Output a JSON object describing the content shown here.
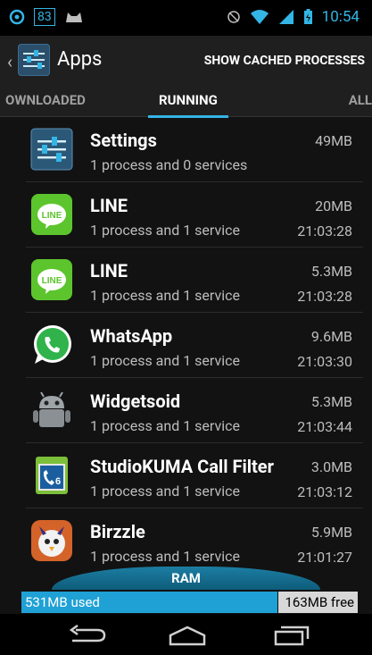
{
  "status": {
    "left_badge": "83",
    "time": "10:54",
    "colors": {
      "accent": "#33b5e5"
    }
  },
  "actionbar": {
    "title": "Apps",
    "action": "SHOW CACHED PROCESSES"
  },
  "tabs": [
    {
      "label": "OWNLOADED"
    },
    {
      "label": "RUNNING"
    },
    {
      "label": "ALL"
    }
  ],
  "apps": [
    {
      "name": "Settings",
      "detail": "1 process and 0 services",
      "size": "49MB",
      "time": "",
      "icon": "settings-icon"
    },
    {
      "name": "LINE",
      "detail": "1 process and 1 service",
      "size": "20MB",
      "time": "21:03:28",
      "icon": "line-icon"
    },
    {
      "name": "LINE",
      "detail": "1 process and 1 service",
      "size": "5.3MB",
      "time": "21:03:28",
      "icon": "line-icon"
    },
    {
      "name": "WhatsApp",
      "detail": "1 process and 1 service",
      "size": "9.6MB",
      "time": "21:03:30",
      "icon": "whatsapp-icon"
    },
    {
      "name": "Widgetsoid",
      "detail": "1 process and 1 service",
      "size": "5.3MB",
      "time": "21:03:44",
      "icon": "android-robot-icon"
    },
    {
      "name": "StudioKUMA Call Filter",
      "detail": "1 process and 1 service",
      "size": "3.0MB",
      "time": "21:03:12",
      "icon": "call-filter-icon"
    },
    {
      "name": "Birzzle",
      "detail": "1 process and 1 service",
      "size": "5.9MB",
      "time": "21:01:27",
      "icon": "birzzle-icon"
    }
  ],
  "ram": {
    "label": "RAM",
    "used": "531MB used",
    "free": "163MB free"
  }
}
